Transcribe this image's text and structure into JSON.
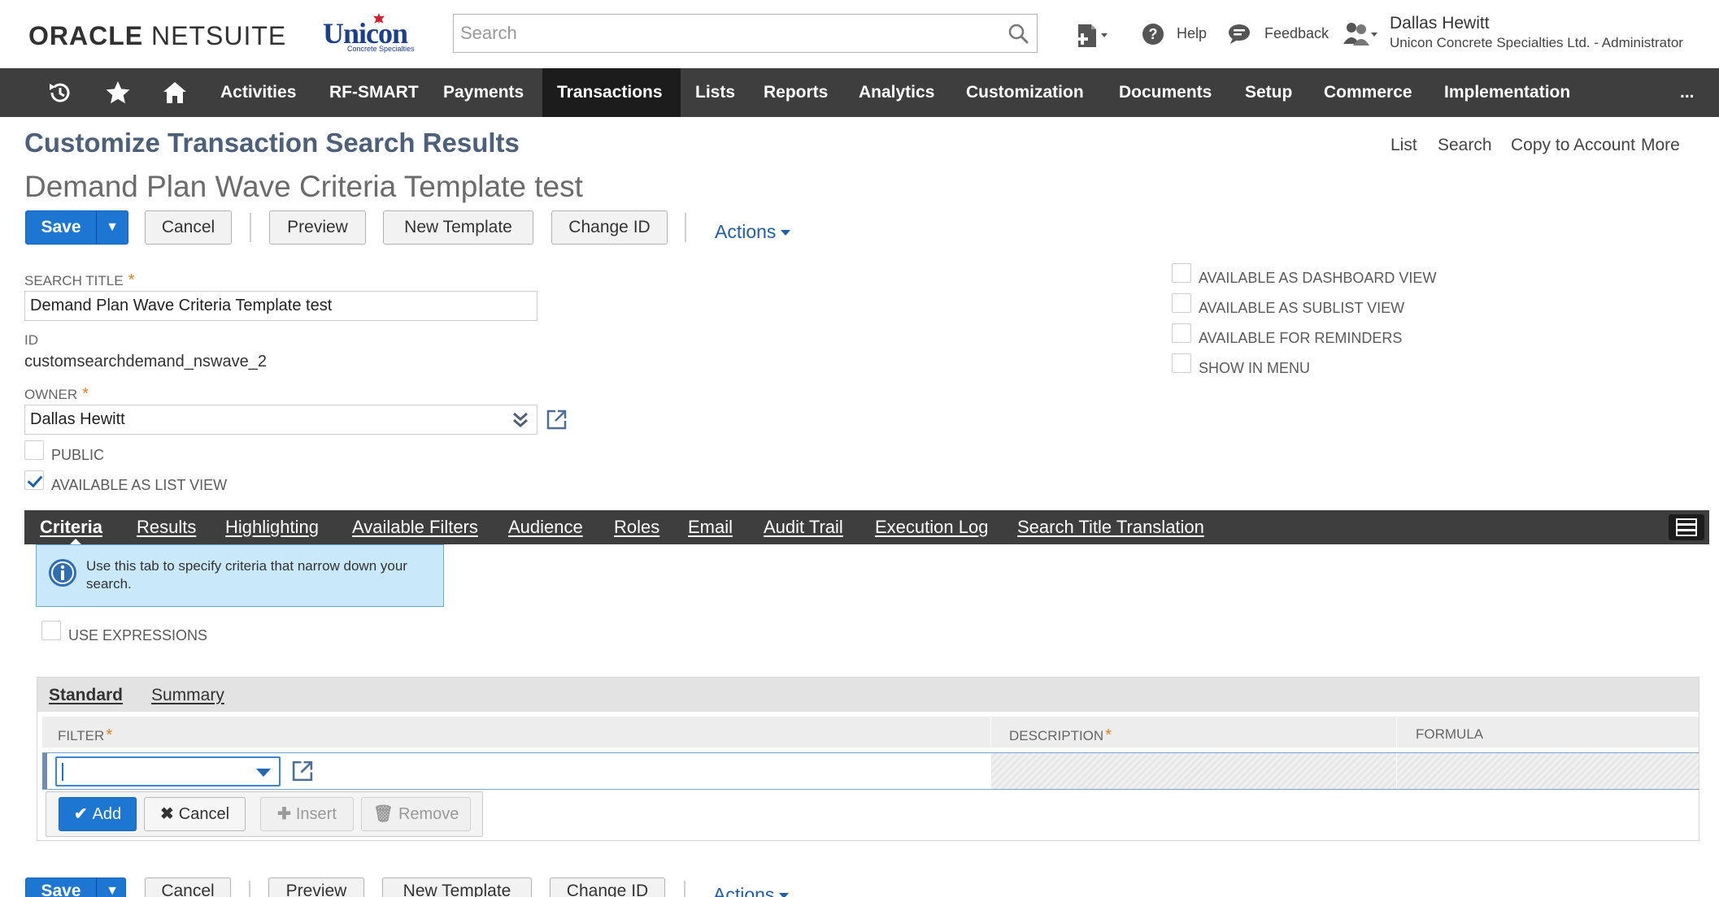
{
  "header": {
    "oracle_logo_bold": "ORACLE",
    "oracle_logo_rest": " NETSUITE",
    "company_logo": "Unicon",
    "company_logo_tag": "Concrete Specialties",
    "search_placeholder": "Search",
    "help_label": "Help",
    "feedback_label": "Feedback",
    "user_name": "Dallas Hewitt",
    "user_role": "Unicon Concrete Specialties Ltd. - Administrator"
  },
  "nav": {
    "items": [
      {
        "label": "Activities"
      },
      {
        "label": "RF-SMART"
      },
      {
        "label": "Payments"
      },
      {
        "label": "Transactions"
      },
      {
        "label": "Lists"
      },
      {
        "label": "Reports"
      },
      {
        "label": "Analytics"
      },
      {
        "label": "Customization"
      },
      {
        "label": "Documents"
      },
      {
        "label": "Setup"
      },
      {
        "label": "Commerce"
      },
      {
        "label": "Implementation"
      }
    ],
    "more": "...",
    "active": "Transactions"
  },
  "page": {
    "title": "Customize Transaction Search Results",
    "subtitle": "Demand Plan Wave Criteria Template test",
    "links": [
      "List",
      "Search",
      "Copy to Account",
      "More"
    ]
  },
  "toolbar": {
    "save": "Save",
    "save_arrow": "▼",
    "cancel": "Cancel",
    "preview": "Preview",
    "new_template": "New Template",
    "change_id": "Change ID",
    "actions": "Actions"
  },
  "form": {
    "search_title_label": "Search Title",
    "required_mark": "*",
    "search_title_value": "Demand Plan Wave Criteria Template test",
    "id_label": "ID",
    "id_value": "customsearchdemand_nswave_2",
    "owner_label": "Owner",
    "owner_value": "Dallas Hewitt",
    "public_label": "Public",
    "public_checked": false,
    "list_view_label": "Available as List View",
    "list_view_checked": true,
    "right_checkboxes": [
      {
        "label": "Available as Dashboard View",
        "checked": false
      },
      {
        "label": "Available as Sublist View",
        "checked": false
      },
      {
        "label": "Available for Reminders",
        "checked": false
      },
      {
        "label": "Show in Menu",
        "checked": false
      }
    ]
  },
  "subtabs": {
    "items": [
      {
        "label": "Criteria"
      },
      {
        "label": "Results"
      },
      {
        "label": "Highlighting"
      },
      {
        "label": "Available Filters"
      },
      {
        "label": "Audience"
      },
      {
        "label": "Roles"
      },
      {
        "label": "Email"
      },
      {
        "label": "Audit Trail"
      },
      {
        "label": "Execution Log"
      },
      {
        "label": "Search Title Translation"
      }
    ],
    "active": "Criteria"
  },
  "criteria": {
    "info_text": "Use this tab to specify criteria that narrow down your search.",
    "use_expressions_label": "Use Expressions",
    "tabs": [
      {
        "label": "Standard"
      },
      {
        "label": "Summary"
      }
    ],
    "columns": {
      "filter": "FILTER",
      "description": "DESCRIPTION",
      "formula": "FORMULA"
    },
    "buttons": {
      "add": "Add",
      "cancel": "Cancel",
      "insert": "Insert",
      "remove": "Remove"
    }
  },
  "colors": {
    "nav_bg": "#3e3e3e",
    "nav_active_bg": "#1c1c1c",
    "primary": "#1c76d2",
    "title": "#4d5f79",
    "required": "#e0811c",
    "link": "#1f5ea8",
    "info_bg": "#c9e8f9"
  }
}
